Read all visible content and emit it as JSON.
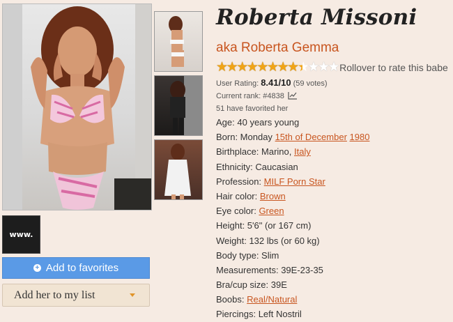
{
  "profile": {
    "name": "Roberta Missoni",
    "aka": "aka Roberta Gemma",
    "rollover_text": "Rollover to rate this babe",
    "user_rating_label": "User Rating:",
    "user_rating_value": "8.41/10",
    "votes": "(59 votes)",
    "current_rank": "Current rank: #4838",
    "favorited": "51 have favorited her",
    "stars_rating": 8.41
  },
  "logo_text": "www.",
  "buttons": {
    "add_favorites": "Add to favorites",
    "add_list": "Add her to my list"
  },
  "details": {
    "age_label": "Age:",
    "age_value": "40 years young",
    "born_label": "Born: Monday",
    "born_day": "15th of December",
    "born_year": "1980",
    "birthplace_label": "Birthplace: Marino,",
    "birthplace_country": "Italy",
    "ethnicity": "Ethnicity: Caucasian",
    "profession_label": "Profession:",
    "profession_value": "MILF Porn Star",
    "hair_label": "Hair color:",
    "hair_value": "Brown",
    "eye_label": "Eye color:",
    "eye_value": "Green",
    "height": "Height: 5'6\" (or 167 cm)",
    "weight": "Weight: 132 lbs (or 60 kg)",
    "body_type": "Body type: Slim",
    "measurements": "Measurements: 39E-23-35",
    "bra": "Bra/cup size: 39E",
    "boobs_label": "Boobs:",
    "boobs_value": "Real/Natural",
    "piercings": "Piercings: Left Nostril"
  },
  "colors": {
    "accent": "#c8551f",
    "button_blue": "#5a9ae6",
    "background": "#f6ebe3",
    "star": "#f0a417"
  }
}
